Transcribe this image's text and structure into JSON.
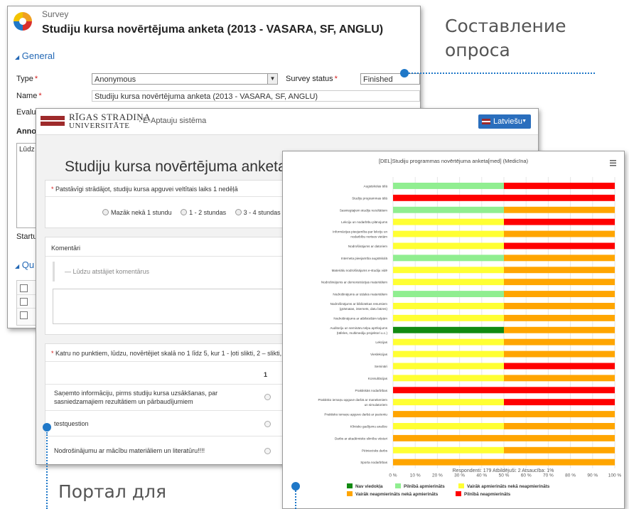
{
  "crm": {
    "entity_label": "Survey",
    "record_title": "Studiju kursa novērtējuma anketa (2013 - VASARA, SF, ANGLU)",
    "section_general": "General",
    "type_label": "Type",
    "type_value": "Anonymous",
    "status_label": "Survey status",
    "status_value": "Finished",
    "name_label": "Name",
    "name_value": "Studiju kursa novērtējuma anketa (2013 - VASARA, SF, ANGLU)",
    "eval_label": "Evalu",
    "anno_label": "Anno",
    "notes_text": "Lūdz",
    "startup_label": "Startu",
    "q_section": "Qu"
  },
  "portal": {
    "uni_line1": "RĪGAS STRADIŅA",
    "uni_line2": "UNIVERSITĀTE",
    "system_name": "E-Aptauju sistēma",
    "language": "Latviešu",
    "page_title": "Studiju kursa novērtējuma anketa",
    "q1_text": "Patstāvīgi strādājot, studiju kursa apguvei veltītais laiks 1 nedēļā",
    "q1_options": [
      "Mazāk nekā 1 stundu",
      "1 - 2 stundas",
      "3 - 4 stundas"
    ],
    "comments_label": "Komentāri",
    "comment_placeholder": "— Lūdzu atstājiet komentārus",
    "q3_text": "Katru no punktiem, lūdzu, novērtējiet skalā no 1 līdz 5, kur 1 - ļoti slikti, 2 – slikti, 3 -",
    "matrix_col": "1",
    "matrix_rows": [
      "Saņemto informāciju, pirms studiju kursa uzsākšanas, par sasniedzamajiem rezultātiem un pārbaudījumiem",
      "testquestion",
      "Nodrošinājumu ar mācību materiāliem un literatūru!!!!"
    ]
  },
  "callouts": {
    "top_right": "Составление опроса",
    "bottom_left": "Портал для"
  },
  "chart_data": {
    "type": "bar",
    "orientation": "horizontal",
    "stacked": true,
    "title": "[DEL]Studiju programmas novērtējuma anketa[med] (Medicīna)",
    "categories": [
      "Augstskolas tēlā",
      "Studiju programmas tēlā",
      "Sasniegtajiem studiju rezultātiem",
      "Lekciju un nodarbību plānojums",
      "Informācijas pieejamība par lekciju un nodarbību norises vietām",
      "Nodrošinājums ar datoriem",
      "Interneta pieejamība augstskolā",
      "Materiālu nodrošinājums e-studiju vidē",
      "Nodrošinājums ar demonstrācijas materiāliem",
      "Nodrošinājums ar izdales materiāliem",
      "Nodrošinājums ar bibliotekas resursiem (grāmatas, internets, datu bāzes)",
      "Nodrošinājums ar atbilstošām telpām",
      "Auditoriju un semināru telpu aprīkojums (tāfeles, multimediju projektori u.c.)",
      "Lekcijas",
      "Vieslekcijas",
      "Semināri",
      "Konsultācijas",
      "Praktiskās nodarbības",
      "Praktisko iemaņu apguve darbā ar manekeniem un simulatoriem",
      "Praktisko iemaņu apguve darbā ar pacientu",
      "Klīnisko gadījumu analīze",
      "Darbs ar akadēmisko slimību vēsturi",
      "Pētniecisks darbs",
      "Sporta nodarbības"
    ],
    "series": [
      {
        "name": "Nav viedokļa",
        "color": "#118a11",
        "values": [
          0,
          0,
          0,
          0,
          0,
          0,
          0,
          0,
          0,
          0,
          0,
          0,
          50,
          0,
          0,
          0,
          0,
          0,
          0,
          0,
          0,
          0,
          0,
          0
        ]
      },
      {
        "name": "Pilnībā apmierināts",
        "color": "#90ee90",
        "values": [
          50,
          0,
          50,
          0,
          0,
          0,
          50,
          0,
          0,
          50,
          0,
          0,
          0,
          0,
          0,
          0,
          0,
          0,
          0,
          0,
          0,
          0,
          0,
          0
        ]
      },
      {
        "name": "Vairāk apmierināts nekā neapmierināts",
        "color": "#ffff33",
        "values": [
          0,
          0,
          0,
          50,
          50,
          50,
          0,
          50,
          50,
          0,
          50,
          50,
          0,
          50,
          50,
          50,
          50,
          0,
          50,
          0,
          50,
          0,
          50,
          0
        ]
      },
      {
        "name": "Vairāk neapmierināts nekā apmierināts",
        "color": "#ffa500",
        "values": [
          0,
          50,
          0,
          0,
          0,
          0,
          0,
          0,
          0,
          0,
          0,
          0,
          0,
          0,
          0,
          0,
          0,
          50,
          0,
          100,
          0,
          100,
          0,
          100
        ]
      },
      {
        "name": "Pilnībā neapmierināts",
        "color": "#ff0000",
        "values": [
          50,
          50,
          50,
          50,
          50,
          50,
          50,
          50,
          50,
          50,
          50,
          50,
          50,
          50,
          50,
          50,
          50,
          50,
          50,
          0,
          50,
          0,
          50,
          0
        ]
      }
    ],
    "series_segments_right": [
      "#ff0000",
      "#ff0000",
      "#ffa500",
      "#ff0000",
      "#ffa500",
      "#ff0000",
      "#ffa500",
      "#ffa500",
      "#ffa500",
      "#ffa500",
      "#ffa500",
      "#ffa500",
      "#ffa500",
      "#ffa500",
      "#ffa500",
      "#ff0000",
      "#ffa500",
      "#ff0000",
      "#ff0000",
      "#ffa500",
      "#ffa500",
      "#ffa500",
      "#ffa500",
      "#ffa500"
    ],
    "x_ticks": [
      "0 %",
      "10 %",
      "20 %",
      "30 %",
      "40 %",
      "50 %",
      "60 %",
      "70 %",
      "80 %",
      "90 %",
      "100 %"
    ],
    "xlim": [
      0,
      100
    ],
    "footnote": "Respondenti: 179 Atbildējuši: 2 Atsaucība: 1%",
    "legend_position": "bottom",
    "menu_icon": "hamburger-icon"
  }
}
